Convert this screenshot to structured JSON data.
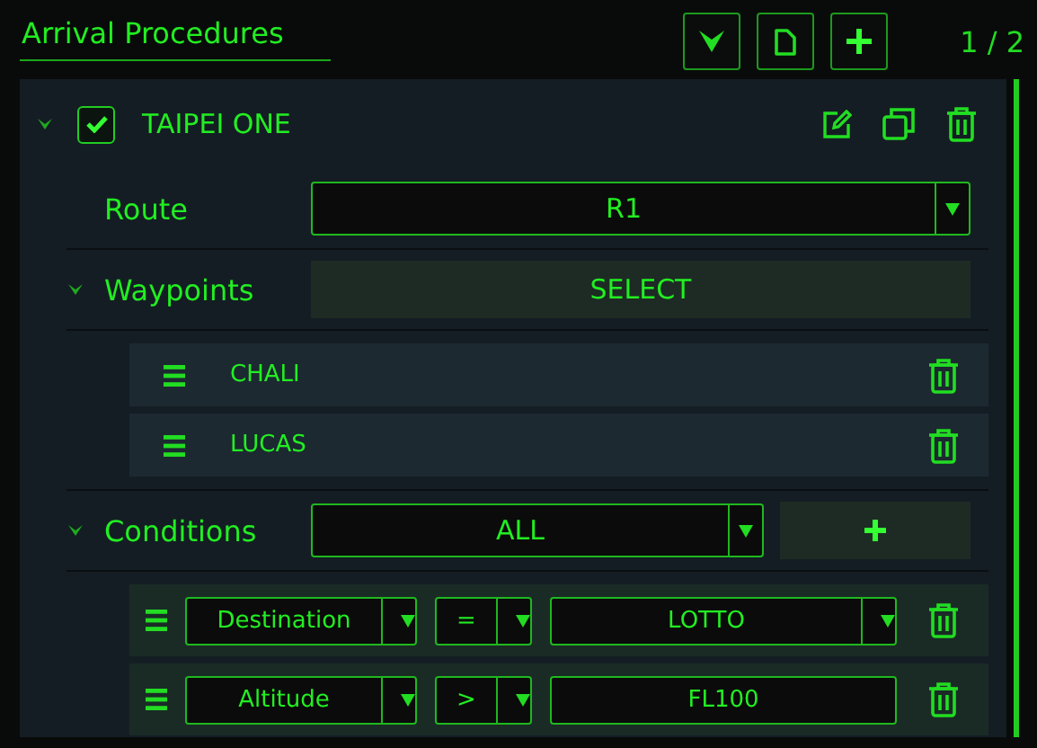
{
  "header": {
    "title": "Arrival Procedures",
    "page": "1 / 2"
  },
  "procedure": {
    "name": "TAIPEI ONE",
    "checked": true,
    "expanded": true,
    "route": {
      "label": "Route",
      "value": "R1"
    },
    "waypoints": {
      "label": "Waypoints",
      "expanded": true,
      "button": "SELECT",
      "items": [
        {
          "name": "CHALI"
        },
        {
          "name": "LUCAS"
        }
      ]
    },
    "conditions": {
      "label": "Conditions",
      "expanded": true,
      "mode": "ALL",
      "items": [
        {
          "field": "Destination",
          "operator": "=",
          "value": "LOTTO",
          "kind": "select"
        },
        {
          "field": "Altitude",
          "operator": ">",
          "value": "FL100",
          "kind": "text"
        }
      ]
    }
  }
}
